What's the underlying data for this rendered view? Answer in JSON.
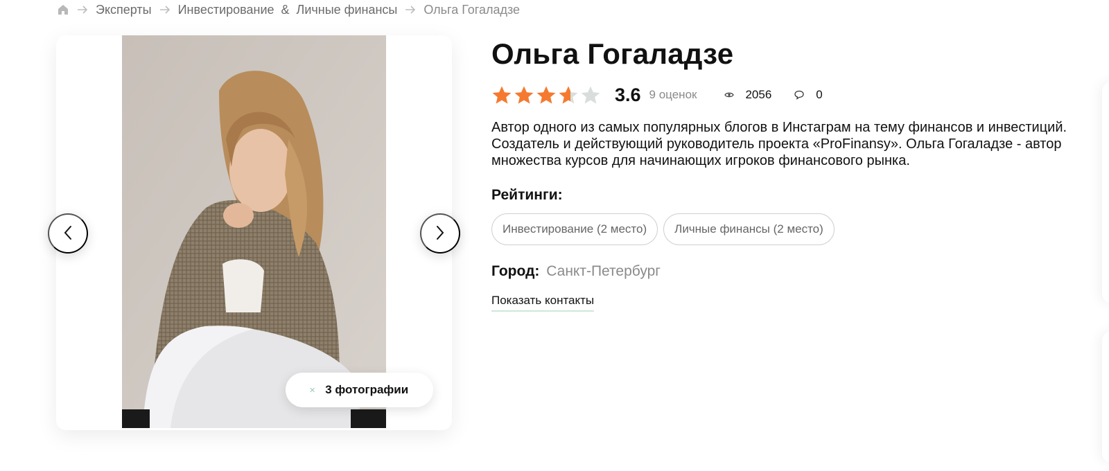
{
  "breadcrumbs": {
    "home_icon": "home-icon",
    "items": [
      {
        "label": "Эксперты"
      },
      {
        "label": "Инвестирование  &  Личные финансы"
      },
      {
        "label": "Ольга Гогаладзе"
      }
    ]
  },
  "gallery": {
    "photos_button_label": "3 фотографии",
    "prev_icon": "chevron-left-icon",
    "next_icon": "chevron-right-icon"
  },
  "expert": {
    "name": "Ольга Гогаладзе",
    "rating": {
      "value": "3.6",
      "stars_filled": 3.6,
      "stars_max": 5,
      "count_label": "9 оценок",
      "star_color": "#f57a2f",
      "star_empty_color": "#d9dedc"
    },
    "views": "2056",
    "comments": "0",
    "description": "Автор одного из самых популярных блогов в Инстаграм на тему финансов и инвестиций. Создатель и действующий руководитель проекта «ProFinansy». Ольга Гогаладзе - автор множества курсов для начинающих игроков финансового рынка.",
    "ratings_label": "Рейтинги:",
    "ratings": [
      {
        "label": "Инвестирование (2 место)"
      },
      {
        "label": "Личные финансы (2 место)"
      }
    ],
    "city_label": "Город:",
    "city": "Санкт-Петербург",
    "show_contacts_label": "Показать контакты"
  }
}
